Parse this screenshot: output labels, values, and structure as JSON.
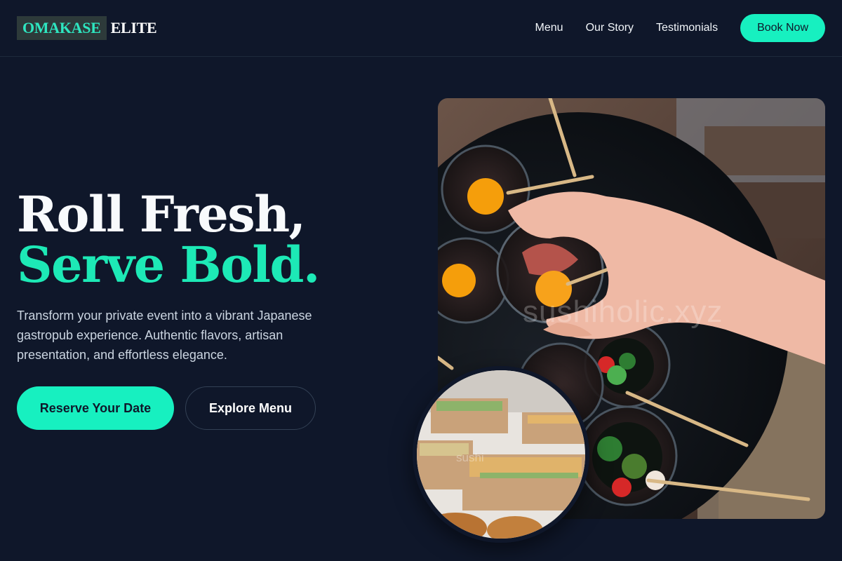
{
  "brand": {
    "mark": "OMAKASE",
    "word": "ELITE"
  },
  "nav": {
    "links": [
      "Menu",
      "Our Story",
      "Testimonials"
    ],
    "cta": "Book Now"
  },
  "hero": {
    "title_line1": "Roll Fresh,",
    "title_line2": "Serve Bold.",
    "description": "Transform your private event into a vibrant Japanese gastropub experience. Authentic flavors, artisan presentation, and effortless elegance.",
    "primary_cta": "Reserve Your Date",
    "secondary_cta": "Explore Menu"
  },
  "images": {
    "main_watermark": "sushiholic.xyz",
    "circle_watermark": "sushi"
  },
  "colors": {
    "background": "#0f172a",
    "accent": "#17f0c0",
    "headline_accent": "#1de9b6"
  }
}
